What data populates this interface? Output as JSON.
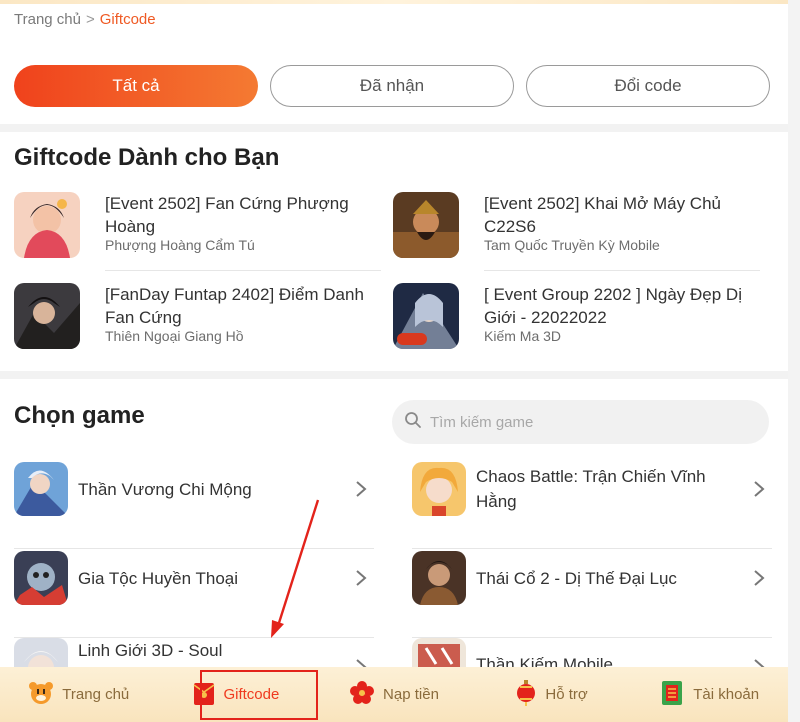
{
  "breadcrumb": {
    "home": "Trang chủ",
    "separator": ">",
    "current": "Giftcode"
  },
  "tabs": [
    {
      "label": "Tất cả",
      "active": true
    },
    {
      "label": "Đã nhận",
      "active": false
    },
    {
      "label": "Đổi code",
      "active": false
    }
  ],
  "giftcode_section": {
    "title": "Giftcode Dành cho Bạn",
    "items": [
      {
        "title": "[Event 2502] Fan Cứng Phượng Hoàng",
        "game": "Phượng Hoàng Cẩm Tú",
        "icon": "game-thumb-phuong-hoang"
      },
      {
        "title": "[Event 2502] Khai Mở Máy Chủ C22S6",
        "game": "Tam Quốc Truyền Kỳ Mobile",
        "icon": "game-thumb-tam-quoc"
      },
      {
        "title": "[FanDay Funtap 2402] Điểm Danh Fan Cứng",
        "game": "Thiên Ngoại Giang Hồ",
        "icon": "game-thumb-thien-ngoai"
      },
      {
        "title": "[ Event Group 2202 ] Ngày Đẹp Dị Giới - 22022022",
        "game": "Kiếm Ma 3D",
        "icon": "game-thumb-kiem-ma"
      }
    ]
  },
  "game_section": {
    "title": "Chọn game",
    "search_placeholder": "Tìm kiếm game",
    "games": [
      {
        "name": "Thần Vương Chi Mộng"
      },
      {
        "name": "Chaos Battle: Trận Chiến Vĩnh Hằng"
      },
      {
        "name": "Gia Tộc Huyền Thoại"
      },
      {
        "name": "Thái Cổ 2 - Dị Thế Đại Lục"
      },
      {
        "name": "Linh Giới 3D - Soul"
      },
      {
        "name": "Thần Kiếm Mobile"
      }
    ]
  },
  "bottom_nav": [
    {
      "label": "Trang chủ",
      "icon": "tiger-icon",
      "active": false
    },
    {
      "label": "Giftcode",
      "icon": "red-envelope-icon",
      "active": true
    },
    {
      "label": "Nạp tiền",
      "icon": "flower-icon",
      "active": false
    },
    {
      "label": "Hỗ trợ",
      "icon": "lantern-icon",
      "active": false
    },
    {
      "label": "Tài khoản",
      "icon": "account-card-icon",
      "active": false
    }
  ],
  "colors": {
    "accent": "#ef5a24",
    "annotation": "#e3231b",
    "nav_bg": "#fdf0d6"
  }
}
